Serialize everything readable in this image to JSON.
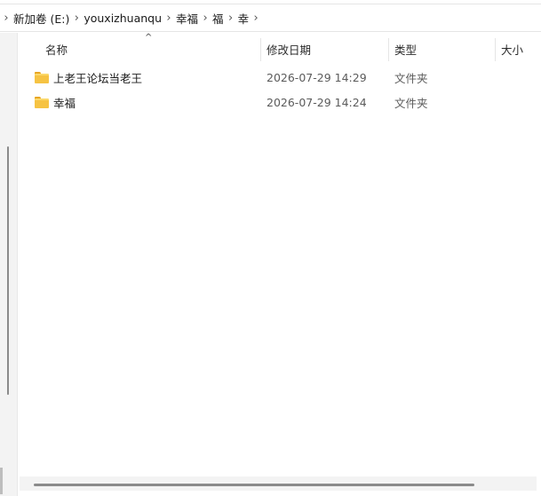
{
  "breadcrumb": {
    "items": [
      "新加卷 (E:)",
      "youxizhuanqu",
      "幸福",
      "福",
      "幸"
    ]
  },
  "columns": {
    "name": "名称",
    "date": "修改日期",
    "type": "类型",
    "size": "大小",
    "sort_indicator": "^"
  },
  "files": [
    {
      "name": "上老王论坛当老王",
      "date": "2026-07-29 14:29",
      "type": "文件夹"
    },
    {
      "name": "幸福",
      "date": "2026-07-29 14:24",
      "type": "文件夹"
    }
  ],
  "icons": {
    "folder": "folder-icon",
    "separator": "chevron-right-icon"
  },
  "colors": {
    "folder": "#f6c343",
    "folder_tab": "#e8a623"
  }
}
